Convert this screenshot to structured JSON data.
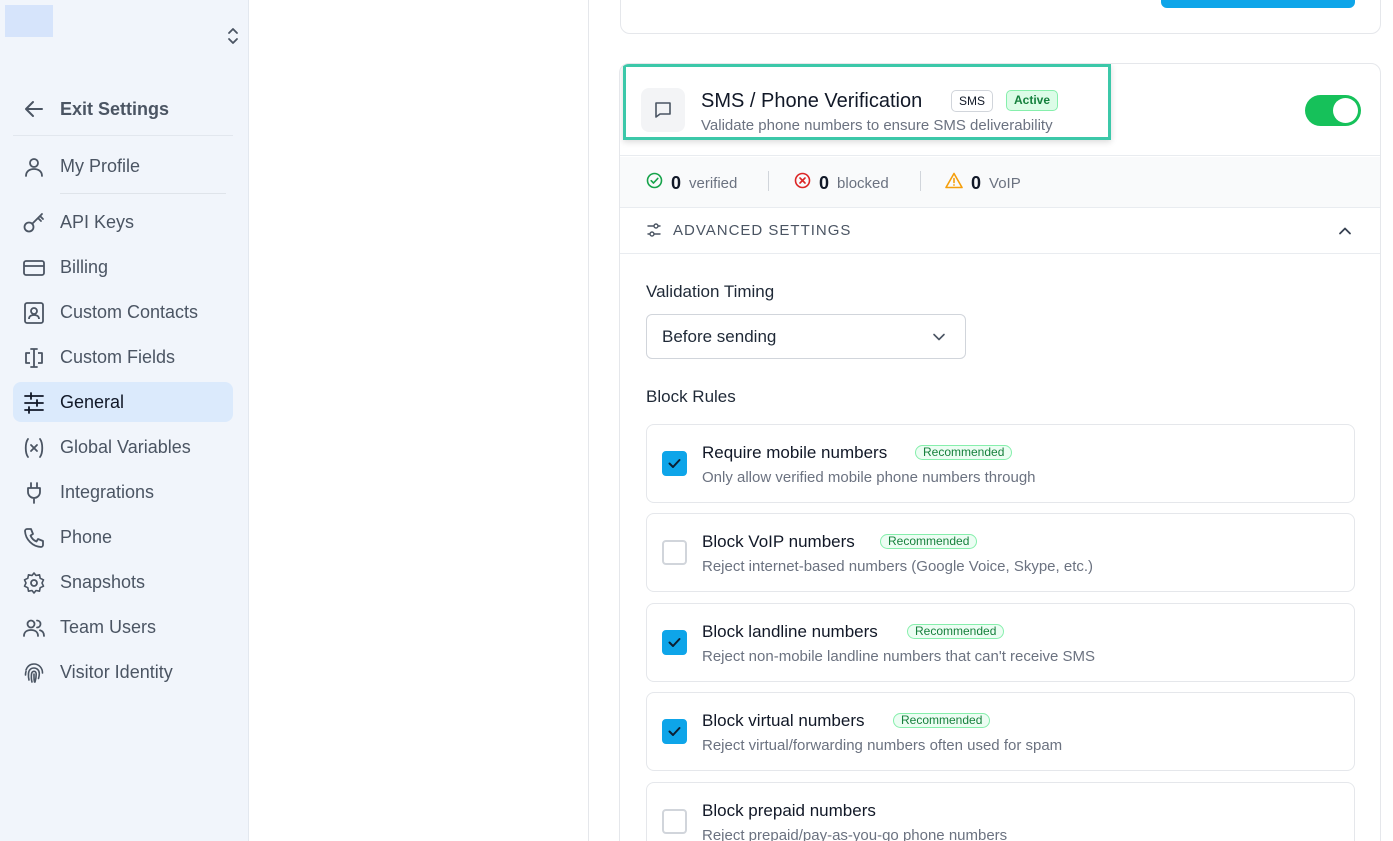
{
  "sidebar": {
    "exit_label": "Exit Settings",
    "items": [
      {
        "label": "My Profile",
        "icon": "user-icon"
      },
      {
        "label": "API Keys",
        "icon": "key-icon"
      },
      {
        "label": "Billing",
        "icon": "credit-card-icon"
      },
      {
        "label": "Custom Contacts",
        "icon": "contact-icon"
      },
      {
        "label": "Custom Fields",
        "icon": "text-field-icon"
      },
      {
        "label": "General",
        "icon": "sliders-icon",
        "active": true
      },
      {
        "label": "Global Variables",
        "icon": "variable-icon"
      },
      {
        "label": "Integrations",
        "icon": "plug-icon"
      },
      {
        "label": "Phone",
        "icon": "phone-icon"
      },
      {
        "label": "Snapshots",
        "icon": "gear-icon"
      },
      {
        "label": "Team Users",
        "icon": "users-icon"
      },
      {
        "label": "Visitor Identity",
        "icon": "fingerprint-icon"
      }
    ]
  },
  "card": {
    "title": "SMS / Phone Verification",
    "badge": "SMS",
    "status": "Active",
    "subtitle": "Validate phone numbers to ensure SMS deliverability",
    "enabled": true,
    "stats": [
      {
        "value": "0",
        "label": "verified",
        "color": "#16a34a"
      },
      {
        "value": "0",
        "label": "blocked",
        "color": "#dc2626"
      },
      {
        "value": "0",
        "label": "VoIP",
        "color": "#f59e0b"
      }
    ],
    "advanced_label": "ADVANCED SETTINGS",
    "timing_label": "Validation Timing",
    "timing_value": "Before sending",
    "block_rules_label": "Block Rules",
    "rules": [
      {
        "name": "Require mobile numbers",
        "badge": "Recommended",
        "desc": "Only allow verified mobile phone numbers through",
        "checked": true
      },
      {
        "name": "Block VoIP numbers",
        "badge": "Recommended",
        "desc": "Reject internet-based numbers (Google Voice, Skype, etc.)",
        "checked": false
      },
      {
        "name": "Block landline numbers",
        "badge": "Recommended",
        "desc": "Reject non-mobile landline numbers that can't receive SMS",
        "checked": true
      },
      {
        "name": "Block virtual numbers",
        "badge": "Recommended",
        "desc": "Reject virtual/forwarding numbers often used for spam",
        "checked": true
      },
      {
        "name": "Block prepaid numbers",
        "badge": "",
        "desc": "Reject prepaid/pay-as-you-go phone numbers",
        "checked": false
      }
    ]
  },
  "colors": {
    "accent": "#0ea5e9",
    "toggle_on": "#16c15a",
    "highlight": "#3cc8a9"
  }
}
